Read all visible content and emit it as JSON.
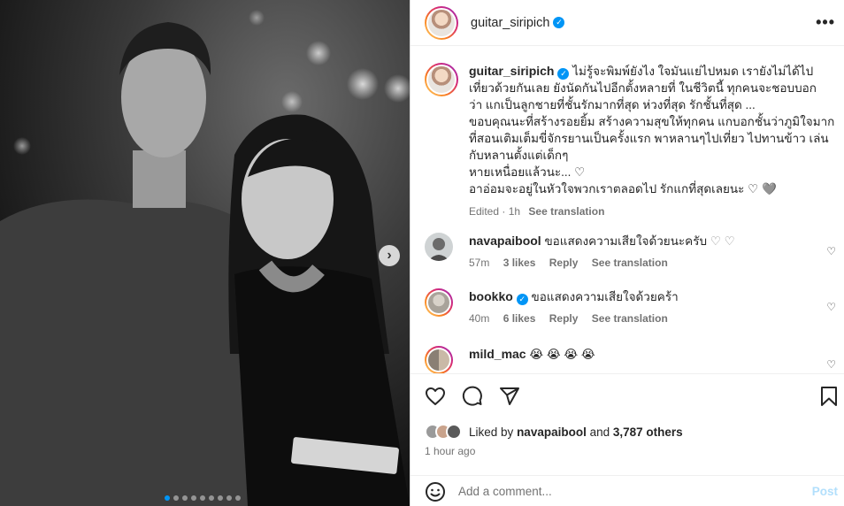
{
  "post": {
    "author": "guitar_siripich",
    "photo_dots": 9,
    "photo_active_dot": 0
  },
  "caption": {
    "username": "guitar_siripich",
    "lines": [
      "ไม่รู้จะพิมพ์ยังไง ใจมันแย่ไปหมด เรายังไม่ได้ไป",
      "เที่ยวด้วยกันเลย ยังนัดกันไปอีกตั้งหลายที่ ในชีวิตนี้ ทุกคนจะชอบบอก",
      "ว่า แกเป็นลูกชายที่ชั้นรักมากที่สุด ห่วงที่สุด รักชั้นที่สุด ...",
      "ขอบคุณนะที่สร้างรอยยิ้ม สร้างความสุขให้ทุกคน แกบอกชั้นว่าภูมิใจมาก",
      "ที่สอนเติมเต็มขี่จักรยานเป็นครั้งแรก พาหลานๆไปเที่ยว ไปทานข้าว เล่น",
      "กับหลานตั้งแต่เด็กๆ",
      "หายเหนื่อยแล้วนะ... ♡",
      "อาอ่อมจะอยู่ในหัวใจพวกเราตลอดไป รักแกที่สุดเลยนะ ♡ 🩶"
    ],
    "edited": "Edited · 1h",
    "see_translation": "See translation"
  },
  "comments": [
    {
      "username": "navapaibool",
      "text": "ขอแสดงความเสียใจด้วยนะครับ",
      "hearts": "♡ ♡",
      "time": "57m",
      "likes": "3 likes",
      "reply": "Reply",
      "see_translation": "See translation"
    },
    {
      "username": "bookko",
      "verified": true,
      "text": "ขอแสดงความเสียใจด้วยคร้า",
      "time": "40m",
      "likes": "6 likes",
      "reply": "Reply",
      "see_translation": "See translation"
    },
    {
      "username": "mild_mac",
      "text": "😭 😭 😭 😭"
    }
  ],
  "likes": {
    "prefix": "Liked by",
    "user": "navapaibool",
    "connector": "and",
    "others": "3,787 others"
  },
  "time_ago": "1 hour ago",
  "add_comment": {
    "placeholder": "Add a comment...",
    "post_label": "Post"
  },
  "colors": {
    "accent": "#0095f6",
    "post_disabled": "#b2dffc",
    "muted_text": "#737373"
  },
  "icons": [
    "more-icon",
    "verified-icon",
    "heart-icon",
    "comment-icon",
    "share-icon",
    "bookmark-icon",
    "emoji-icon",
    "chevron-right-icon"
  ]
}
